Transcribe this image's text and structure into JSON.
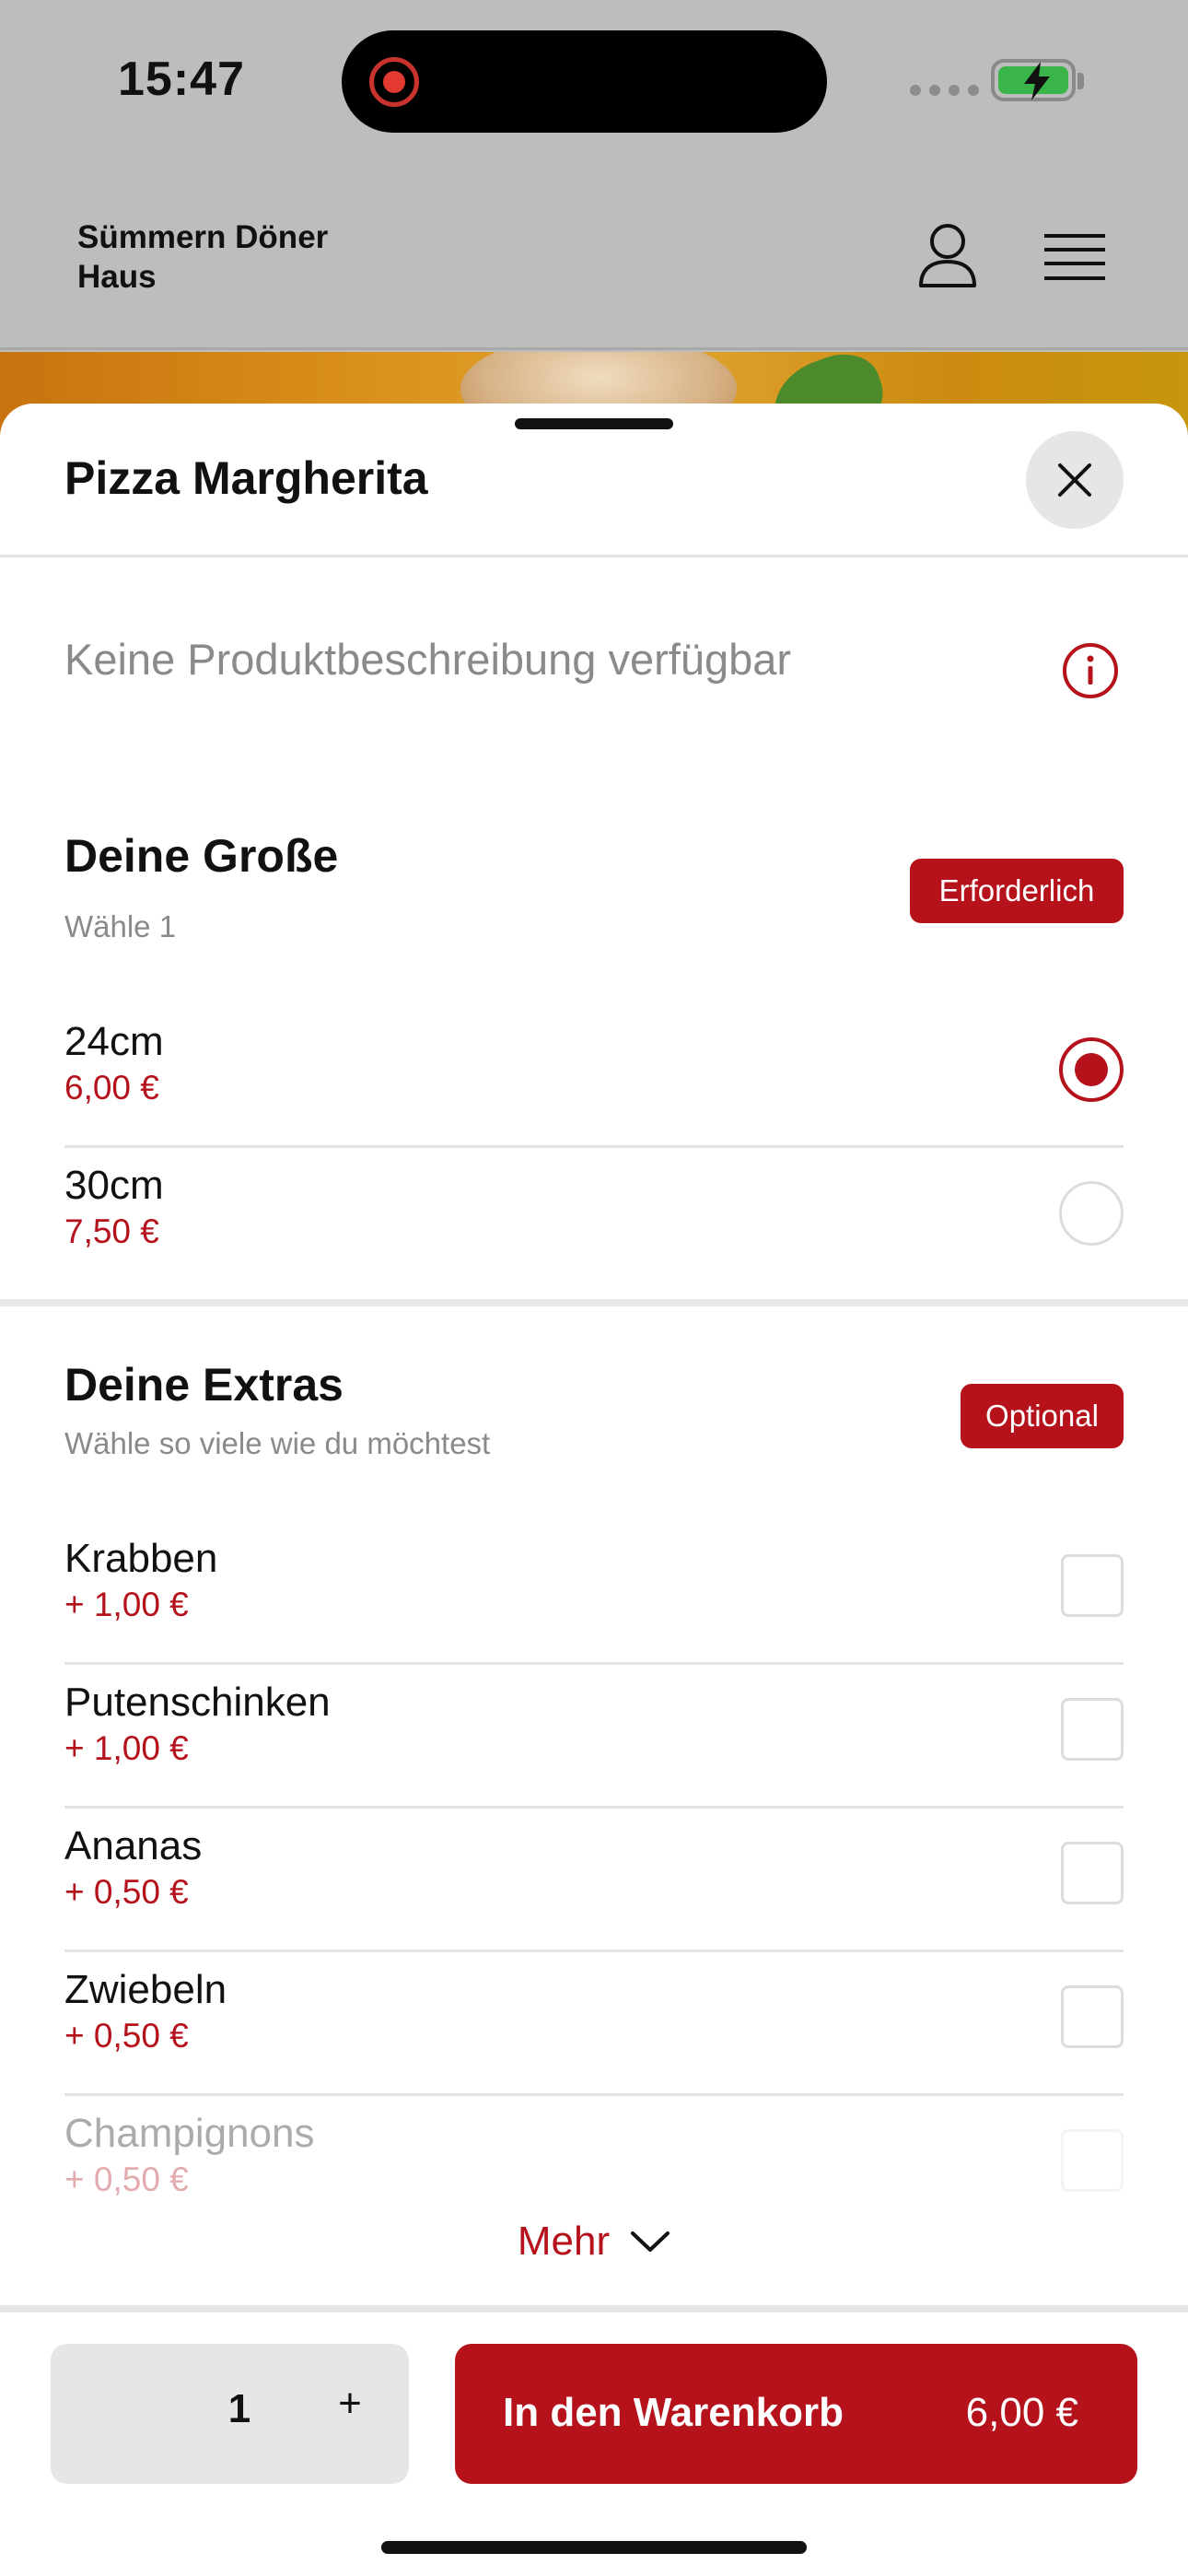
{
  "status_bar": {
    "time": "15:47"
  },
  "app": {
    "brand": "Sümmern Döner Haus"
  },
  "product": {
    "title": "Pizza Margherita",
    "description": "Keine Produktbeschreibung verfügbar"
  },
  "size_group": {
    "title": "Deine Große",
    "subtitle": "Wähle 1",
    "badge": "Erforderlich",
    "options": [
      {
        "name": "24cm",
        "price": "6,00 €",
        "selected": true
      },
      {
        "name": "30cm",
        "price": "7,50 €",
        "selected": false
      }
    ]
  },
  "extras_group": {
    "title": "Deine Extras",
    "subtitle": "Wähle so viele wie du möchtest",
    "badge": "Optional",
    "options": [
      {
        "name": "Krabben",
        "price": "+ 1,00 €"
      },
      {
        "name": "Putenschinken",
        "price": "+ 1,00 €"
      },
      {
        "name": "Ananas",
        "price": "+ 0,50 €"
      },
      {
        "name": "Zwiebeln",
        "price": "+ 0,50 €"
      },
      {
        "name": "Champignons",
        "price": "+ 0,50 €"
      }
    ]
  },
  "more": {
    "label": "Mehr"
  },
  "footer": {
    "quantity": "1",
    "plus": "+",
    "cart_label": "In den Warenkorb",
    "cart_price": "6,00 €"
  },
  "colors": {
    "accent": "#b5121b",
    "muted": "#8a8a8a"
  }
}
